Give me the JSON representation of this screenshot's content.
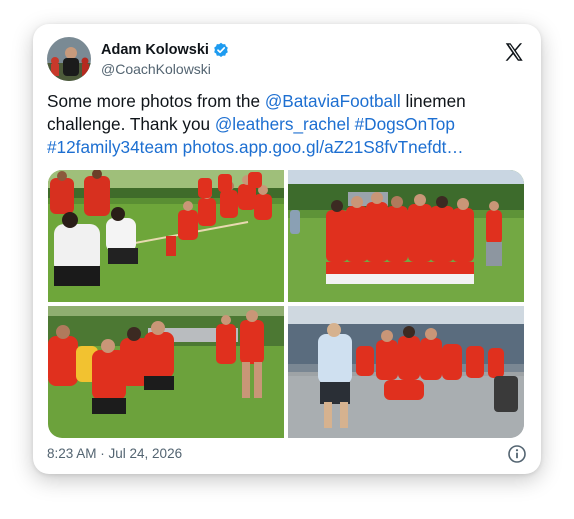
{
  "author": {
    "display_name": "Adam Kolowski",
    "handle": "@CoachKolowski",
    "verified": true
  },
  "post": {
    "text_prefix": "Some more photos from the ",
    "mention_team": "@BataviaFootball",
    "text_middle": " linemen challenge. Thank you ",
    "mention_person": "@leathers_rachel",
    "hashtag_1": "#DogsOnTop",
    "hashtag_2": "#12family34team",
    "link": "photos.app.goo.gl/aZ21S8fvTnefdt…"
  },
  "media": {
    "photos": [
      {
        "subject": "tug-of-war"
      },
      {
        "subject": "team-group"
      },
      {
        "subject": "tug-of-war-close"
      },
      {
        "subject": "coach-and-players"
      }
    ]
  },
  "footer": {
    "timestamp": "8:23 AM · Jul 24, 2026"
  },
  "icons": {
    "verified": "verified-badge-icon",
    "brand": "x-logo-icon",
    "info": "info-icon"
  },
  "colors": {
    "link": "#1d6fd1",
    "verified": "#1d9bf0",
    "text": "#0f1419",
    "muted": "#536471",
    "jersey": "#e0301e"
  }
}
